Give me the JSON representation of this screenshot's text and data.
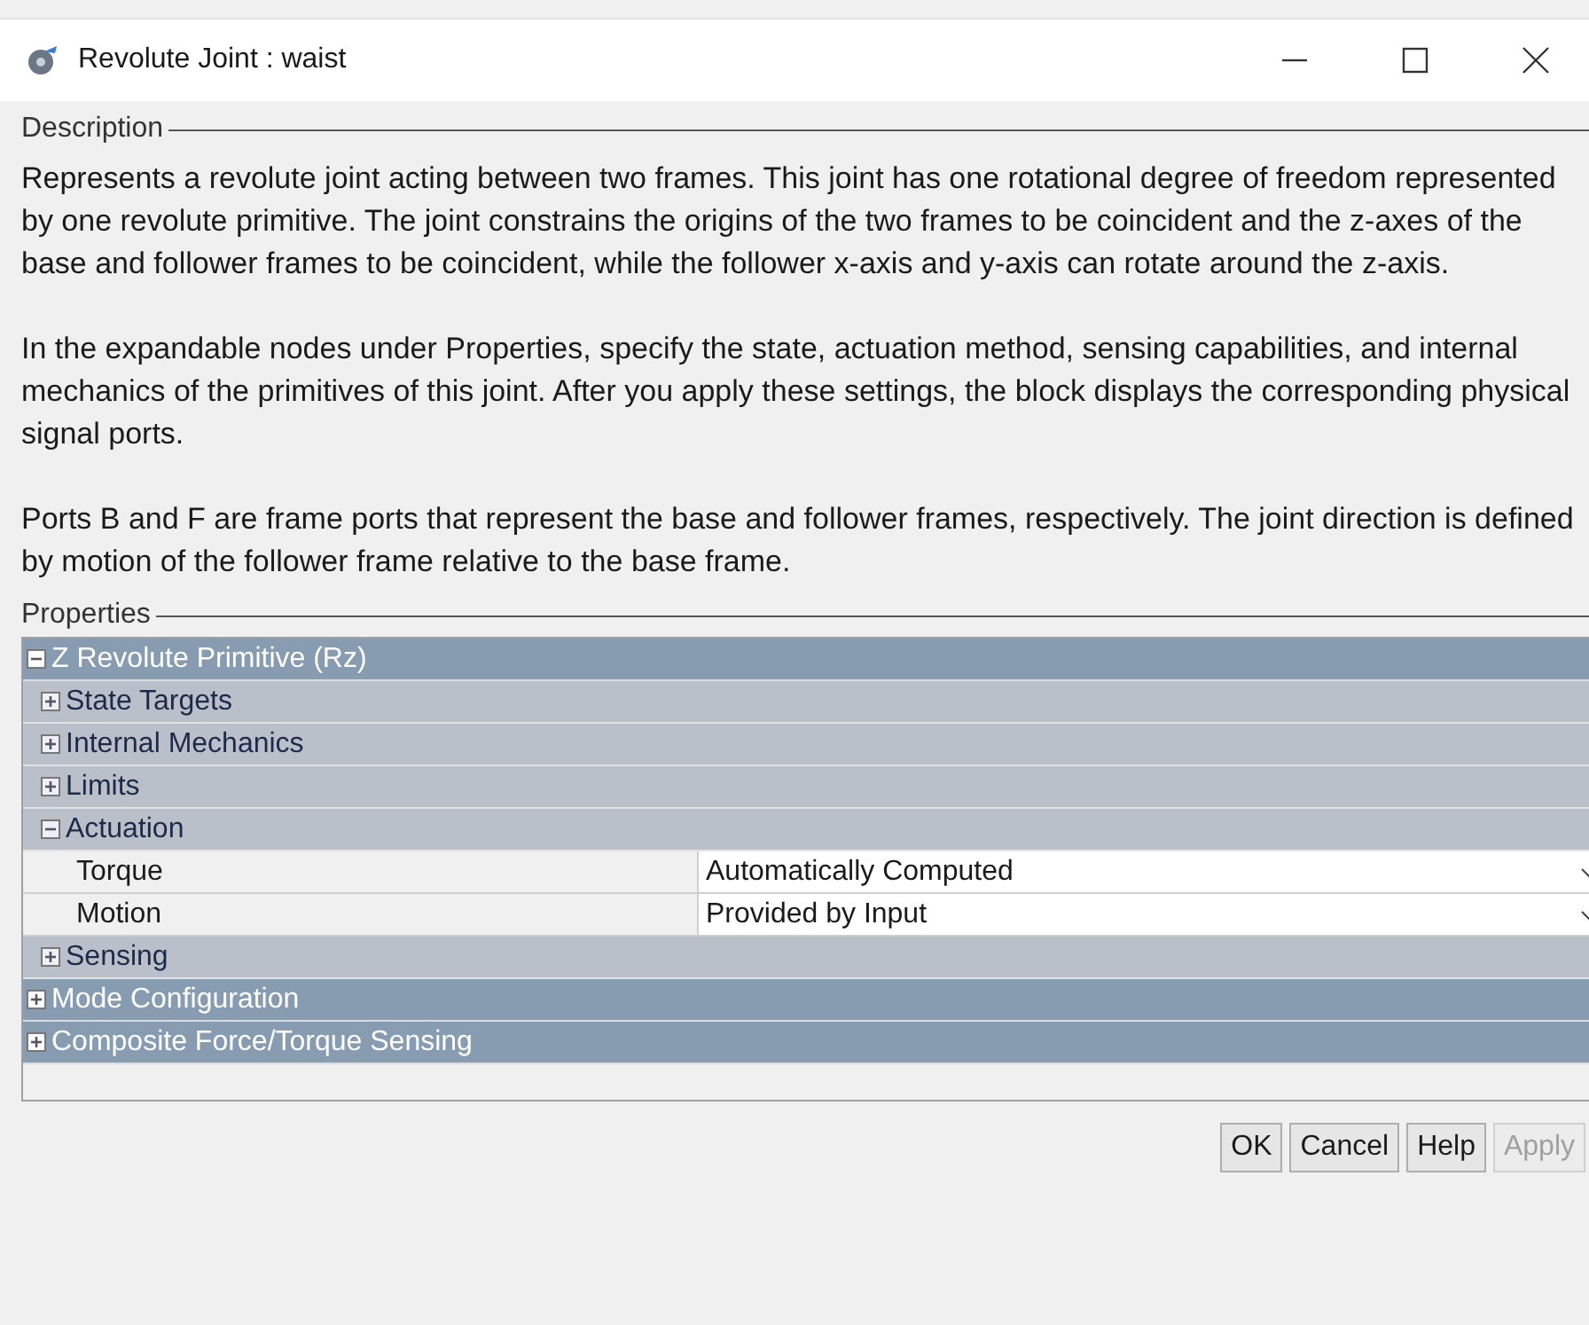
{
  "window": {
    "title": "Revolute Joint : waist"
  },
  "description": {
    "legend": "Description",
    "paragraphs": [
      "Represents a revolute joint acting between two frames. This joint has one rotational degree of freedom represented by one revolute primitive. The joint constrains the origins of the two frames to be coincident and the z-axes of the base and follower frames to be coincident, while the follower x-axis and y-axis can rotate around the z-axis.",
      "In the expandable nodes under Properties, specify the state, actuation method, sensing capabilities, and internal mechanics of the primitives of this joint. After you apply these settings, the block displays the corresponding physical signal ports.",
      "Ports B and F are frame ports that represent the base and follower frames, respectively. The joint direction is defined by motion of the follower frame relative to the base frame."
    ]
  },
  "properties": {
    "legend": "Properties",
    "nodes": [
      {
        "kind": "group",
        "label": "Z Revolute Primitive (Rz)",
        "expanded": true,
        "children": [
          {
            "kind": "group",
            "label": "State Targets",
            "expanded": false
          },
          {
            "kind": "group",
            "label": "Internal Mechanics",
            "expanded": false
          },
          {
            "kind": "group",
            "label": "Limits",
            "expanded": false
          },
          {
            "kind": "group",
            "label": "Actuation",
            "expanded": true,
            "children": [
              {
                "kind": "parameter",
                "label": "Torque",
                "value": "Automatically Computed"
              },
              {
                "kind": "parameter",
                "label": "Motion",
                "value": "Provided by Input"
              }
            ]
          },
          {
            "kind": "group",
            "label": "Sensing",
            "expanded": false
          }
        ]
      },
      {
        "kind": "group",
        "label": "Mode Configuration",
        "expanded": false
      },
      {
        "kind": "group",
        "label": "Composite Force/Torque Sensing",
        "expanded": false
      }
    ]
  },
  "buttons": [
    {
      "label": "OK",
      "disabled": false
    },
    {
      "label": "Cancel",
      "disabled": false
    },
    {
      "label": "Help",
      "disabled": false
    },
    {
      "label": "Apply",
      "disabled": true
    }
  ]
}
